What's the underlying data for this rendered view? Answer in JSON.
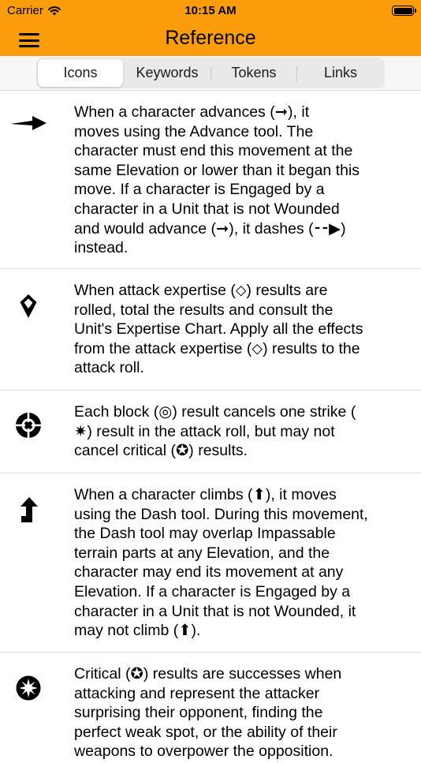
{
  "status": {
    "carrier": "Carrier",
    "time": "10:15 AM",
    "battery_level": 1.0
  },
  "nav": {
    "title": "Reference"
  },
  "tabs": [
    {
      "label": "Icons",
      "selected": true
    },
    {
      "label": "Keywords",
      "selected": false
    },
    {
      "label": "Tokens",
      "selected": false
    },
    {
      "label": "Links",
      "selected": false
    }
  ],
  "rows": [
    {
      "icon": "advance-arrow-icon",
      "text": "When a character advances (➞), it\nmoves using the Advance tool. The\ncharacter must end this movement at the\nsame Elevation or lower than it began this\nmove. If a character is Engaged by a\ncharacter in a Unit that is not Wounded\nand would advance (➞), it dashes (⁃⁃▶)\ninstead."
    },
    {
      "icon": "attack-expertise-icon",
      "text": "When attack expertise (⬦) results are\nrolled, total the results and consult the\nUnit's Expertise Chart. Apply all the effects\nfrom the attack expertise (⬦) results to the\nattack roll."
    },
    {
      "icon": "block-icon",
      "text": "Each block (◎) result cancels one strike (\n✷) result in the attack roll, but may not\ncancel critical (✪) results."
    },
    {
      "icon": "climb-icon",
      "text": "When a character climbs (⬆), it moves\nusing the Dash tool. During this movement,\nthe Dash tool may overlap Impassable\nterrain parts at any Elevation, and the\ncharacter may end its movement at any\nElevation. If a character is Engaged by a\ncharacter in a Unit that is not Wounded, it\nmay not climb (⬆)."
    },
    {
      "icon": "critical-icon",
      "text": "Critical (✪) results are successes when\nattacking and represent the attacker\nsurprising their opponent, finding the\nperfect weak spot, or the ability of their\nweapons to overpower the opposition."
    }
  ],
  "colors": {
    "header": "#fb9d0b",
    "segment_bg": "#e9e9ea",
    "text": "#000000"
  }
}
